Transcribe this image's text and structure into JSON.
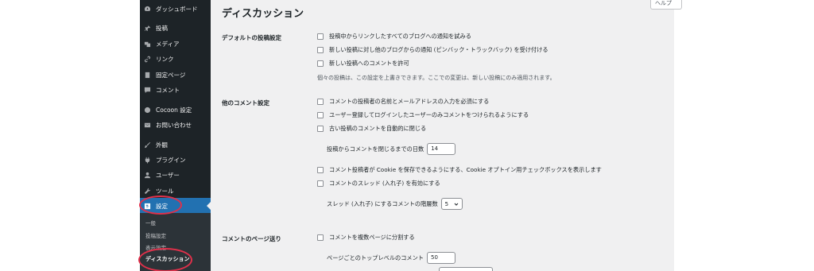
{
  "sidebar": {
    "items": [
      {
        "label": "ダッシュボード",
        "icon": "dashboard-icon"
      },
      {
        "label": "投稿",
        "icon": "pin-icon"
      },
      {
        "label": "メディア",
        "icon": "media-icon"
      },
      {
        "label": "リンク",
        "icon": "link-icon"
      },
      {
        "label": "固定ページ",
        "icon": "page-icon"
      },
      {
        "label": "コメント",
        "icon": "comment-icon"
      },
      {
        "label": "Cocoon 設定",
        "icon": "cocoon-icon"
      },
      {
        "label": "お問い合わせ",
        "icon": "mail-icon"
      },
      {
        "label": "外観",
        "icon": "brush-icon"
      },
      {
        "label": "プラグイン",
        "icon": "plugin-icon"
      },
      {
        "label": "ユーザー",
        "icon": "user-icon"
      },
      {
        "label": "ツール",
        "icon": "wrench-icon"
      },
      {
        "label": "設定",
        "icon": "settings-icon",
        "active": true
      }
    ],
    "submenu": [
      {
        "label": "一般"
      },
      {
        "label": "投稿設定"
      },
      {
        "label": "表示設定"
      },
      {
        "label": "ディスカッション",
        "current": true
      }
    ]
  },
  "header": {
    "title": "ディスカッション",
    "help_tab": "ヘルプ"
  },
  "sections": {
    "default_post": {
      "label": "デフォルトの投稿設定",
      "options": [
        "投稿中からリンクしたすべてのブログへの通知を試みる",
        "新しい投稿に対し他のブログからの通知 (ピンバック・トラックバック) を受け付ける",
        "新しい投稿へのコメントを許可"
      ],
      "description": "個々の投稿は、この設定を上書きできます。ここでの変更は、新しい投稿にのみ適用されます。"
    },
    "other_comment": {
      "label": "他のコメント設定",
      "options": [
        "コメントの投稿者の名前とメールアドレスの入力を必須にする",
        "ユーザー登録してログインしたユーザーのみコメントをつけられるようにする",
        "古い投稿のコメントを自動的に閉じる"
      ],
      "close_days_label": "投稿からコメントを閉じるまでの日数",
      "close_days_value": "14",
      "options2": [
        "コメント投稿者が Cookie を保存できるようにする、Cookie オプトイン用チェックボックスを表示します",
        "コメントのスレッド (入れ子) を有効にする"
      ],
      "thread_depth_label": "スレッド (入れ子) にするコメントの階層数",
      "thread_depth_value": "5"
    },
    "paging": {
      "label": "コメントのページ送り",
      "options": [
        "コメントを複数ページに分割する"
      ],
      "per_page_label": "ページごとのトップレベルのコメント",
      "per_page_value": "50"
    }
  },
  "colors": {
    "sidebar_bg": "#1d2327",
    "active_bg": "#2271b1",
    "content_bg": "#f0f0f1",
    "annotation": "#e0304a"
  }
}
